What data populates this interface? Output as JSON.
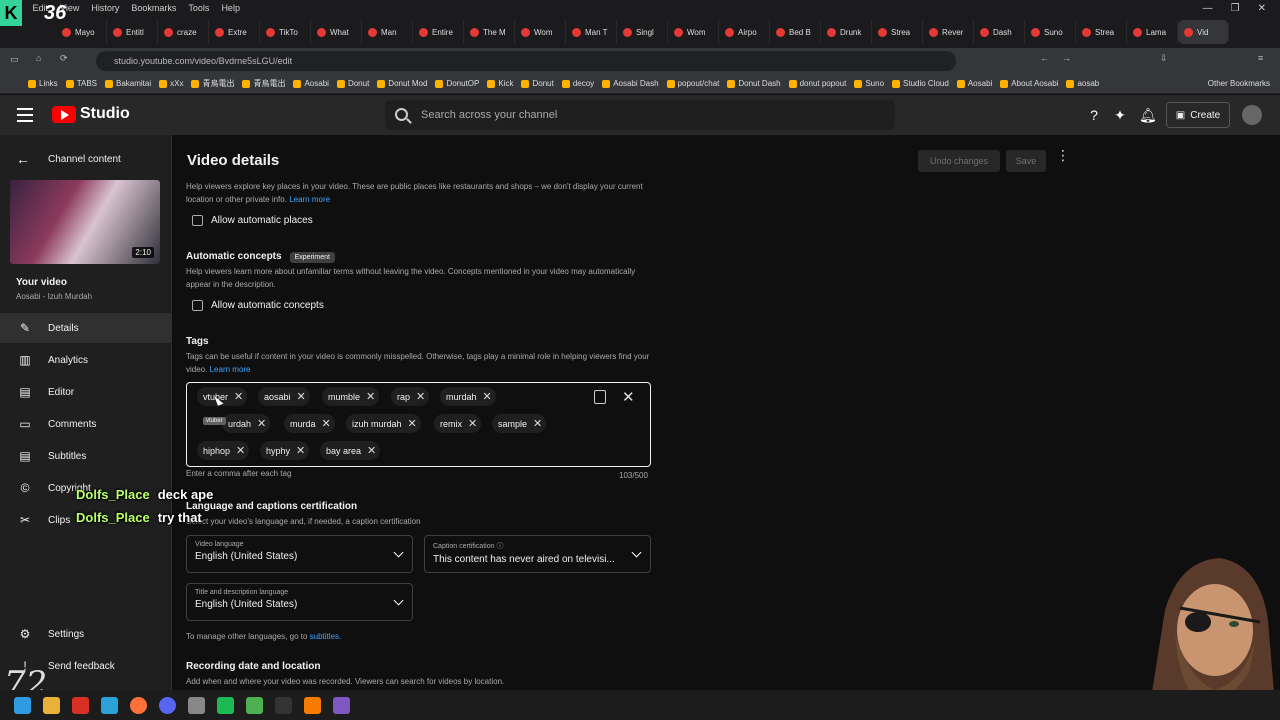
{
  "browser": {
    "menu": [
      "File",
      "Edit",
      "View",
      "History",
      "Bookmarks",
      "Tools",
      "Help"
    ],
    "tabs": [
      "Mayo",
      "Entitl",
      "craze",
      "Extre",
      "TikTo",
      "What",
      "Man",
      "Entire",
      "The M",
      "Wom",
      "Man T",
      "Singl",
      "Wom",
      "Airpo",
      "Bed B",
      "Drunk",
      "Strea",
      "Rever",
      "Dash",
      "Suno",
      "Strea",
      "Lama",
      "Vid"
    ],
    "url": "studio.youtube.com/video/Bvdrne5sLGU/edit",
    "bookmarks": [
      "Links",
      "TABS",
      "Bakamitai",
      "xXx",
      "青鳥電出",
      "青鳥電出",
      "Aosabi",
      "Donut",
      "Donut Mod",
      "DonutOP",
      "Kick",
      "Donut",
      "decoy",
      "Aosabi Dash",
      "popout/chat",
      "Donut Dash",
      "donut popout",
      "Suno",
      "Studio Cloud",
      "Aosabi",
      "About Aosabi",
      "aosab"
    ],
    "other_bookmarks": "Other Bookmarks"
  },
  "header": {
    "logo_text": "Studio",
    "search_placeholder": "Search across your channel",
    "create_label": "Create"
  },
  "sidebar": {
    "back_label": "Channel content",
    "thumb_duration": "2:10",
    "your_video": "Your video",
    "video_subtitle": "Aosabi - Izuh Murdah",
    "items": [
      {
        "label": "Details",
        "icon": "pencil-icon"
      },
      {
        "label": "Analytics",
        "icon": "analytics-icon"
      },
      {
        "label": "Editor",
        "icon": "film-icon"
      },
      {
        "label": "Comments",
        "icon": "comment-icon"
      },
      {
        "label": "Subtitles",
        "icon": "subtitles-icon"
      },
      {
        "label": "Copyright",
        "icon": "copyright-icon"
      },
      {
        "label": "Clips",
        "icon": "scissors-icon"
      }
    ],
    "settings_label": "Settings",
    "feedback_label": "Send feedback"
  },
  "main": {
    "title": "Video details",
    "undo_label": "Undo changes",
    "save_label": "Save",
    "places_help": "Help viewers explore key places in your video. These are public places like restaurants and shops – we don't display your current location or other private info.",
    "learn_more": "Learn more",
    "allow_places": "Allow automatic places",
    "concepts_title": "Automatic concepts",
    "concepts_badge": "Experiment",
    "concepts_help": "Help viewers learn more about unfamiliar terms without leaving the video. Concepts mentioned in your video may automatically appear in the description.",
    "allow_concepts": "Allow automatic concepts",
    "tags_title": "Tags",
    "tags_help": "Tags can be useful if content in your video is commonly misspelled. Otherwise, tags play a minimal role in helping viewers find your video.",
    "tags": [
      "vtuber",
      "aosabi",
      "mumble",
      "rap",
      "murdah",
      "izuh murdah",
      "murda",
      "izuh murdah",
      "remix",
      "sample",
      "hiphop",
      "hyphy",
      "bay area"
    ],
    "tags_visible": [
      "vtuber",
      "aosabi",
      "mumble",
      "rap",
      "murdah",
      "urdah",
      "murda",
      "izuh murdah",
      "remix",
      "sample",
      "hiphop",
      "hyphy",
      "bay area"
    ],
    "tag_tooltip": "vtuber",
    "tags_hint": "Enter a comma after each tag",
    "tags_count": "103/500",
    "lang_title": "Language and captions certification",
    "lang_help": "Select your video's language and, if needed, a caption certification",
    "video_language_label": "Video language",
    "video_language_value": "English (United States)",
    "caption_label": "Caption certification",
    "caption_value": "This content has never aired on televisi...",
    "title_lang_label": "Title and description language",
    "title_lang_value": "English (United States)",
    "manage_text": "To manage other languages, go to",
    "subtitles_link": "subtitles.",
    "recording_title": "Recording date and location",
    "recording_help": "Add when and where your video was recorded. Viewers can search for videos by location."
  },
  "overlay": {
    "stream_count": "36",
    "chat": [
      {
        "user": "Dolfs_Place",
        "msg": "deck ape"
      },
      {
        "user": "Dolfs_Place",
        "msg": "try that"
      }
    ]
  },
  "colors": {
    "accent": "#3ea6ff",
    "brand": "#ff0000",
    "chat_user": "#b8ff6a"
  }
}
